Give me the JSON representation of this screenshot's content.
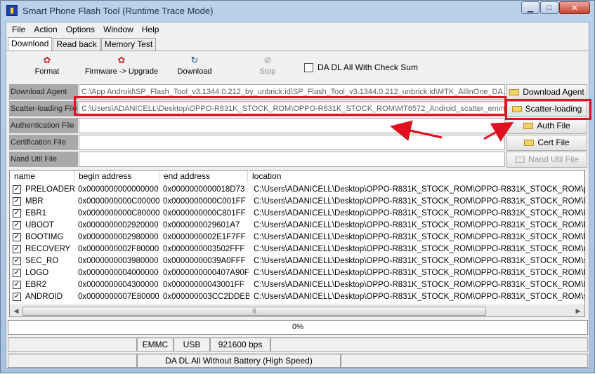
{
  "window": {
    "title": "Smart Phone Flash Tool (Runtime Trace Mode)",
    "minimize_glyph": "▁",
    "maximize_glyph": "□",
    "close_glyph": "✕"
  },
  "menu": [
    "File",
    "Action",
    "Options",
    "Window",
    "Help"
  ],
  "tabs": [
    "Download",
    "Read back",
    "Memory Test"
  ],
  "toolbar": {
    "format": "Format",
    "firmware_upgrade": "Firmware -> Upgrade",
    "download": "Download",
    "stop": "Stop",
    "checksum": "DA DL All With Check Sum"
  },
  "form": {
    "download_agent_label": "Download Agent",
    "download_agent_value": "C:\\App Android\\SP_Flash_Tool_v3.1344.0.212_by_unbrick.id\\SP_Flash_Tool_v3.1344.0.212_unbrick.id\\MTK_AllInOne_DA.bin",
    "scatter_label": "Scatter-loading File",
    "scatter_value": "C:\\Users\\ADANICELL\\Desktop\\OPPO-R831K_STOCK_ROM\\OPPO-R831K_STOCK_ROM\\MT6572_Android_scatter_emmc.txt",
    "auth_label": "Authentication File",
    "cert_label": "Certification File",
    "nand_label": "Nand Util File"
  },
  "side_buttons": {
    "download_agent": "Download Agent",
    "scatter_loading": "Scatter-loading",
    "auth_file": "Auth File",
    "cert_file": "Cert File",
    "nand_util": "Nand Util File"
  },
  "table": {
    "headers": [
      "name",
      "begin address",
      "end address",
      "location"
    ],
    "rows": [
      {
        "name": "PRELOADER",
        "begin": "0x0000000000000000",
        "end": "0x0000000000018D73",
        "location": "C:\\Users\\ADANICELL\\Desktop\\OPPO-R831K_STOCK_ROM\\OPPO-R831K_STOCK_ROM\\pre"
      },
      {
        "name": "MBR",
        "begin": "0x0000000000C00000",
        "end": "0x0000000000C001FF",
        "location": "C:\\Users\\ADANICELL\\Desktop\\OPPO-R831K_STOCK_ROM\\OPPO-R831K_STOCK_ROM\\MB"
      },
      {
        "name": "EBR1",
        "begin": "0x0000000000C80000",
        "end": "0x0000000000C801FF",
        "location": "C:\\Users\\ADANICELL\\Desktop\\OPPO-R831K_STOCK_ROM\\OPPO-R831K_STOCK_ROM\\EB"
      },
      {
        "name": "UBOOT",
        "begin": "0x0000000002920000",
        "end": "0x0000000029601A7",
        "location": "C:\\Users\\ADANICELL\\Desktop\\OPPO-R831K_STOCK_ROM\\OPPO-R831K_STOCK_ROM\\lk.b"
      },
      {
        "name": "BOOTIMG",
        "begin": "0x0000000002980000",
        "end": "0x0000000002E1F7FF",
        "location": "C:\\Users\\ADANICELL\\Desktop\\OPPO-R831K_STOCK_ROM\\OPPO-R831K_STOCK_ROM\\boo"
      },
      {
        "name": "RECOVERY",
        "begin": "0x0000000002F80000",
        "end": "0x0000000003502FFF",
        "location": "C:\\Users\\ADANICELL\\Desktop\\OPPO-R831K_STOCK_ROM\\OPPO-R831K_STOCK_ROM\\rec"
      },
      {
        "name": "SEC_RO",
        "begin": "0x0000000003980000",
        "end": "0x00000000039A0FFF",
        "location": "C:\\Users\\ADANICELL\\Desktop\\OPPO-R831K_STOCK_ROM\\OPPO-R831K_STOCK_ROM\\sec"
      },
      {
        "name": "LOGO",
        "begin": "0x0000000004000000",
        "end": "0x0000000000407A90F",
        "location": "C:\\Users\\ADANICELL\\Desktop\\OPPO-R831K_STOCK_ROM\\OPPO-R831K_STOCK_ROM\\log"
      },
      {
        "name": "EBR2",
        "begin": "0x0000000004300000",
        "end": "0x00000000043001FF",
        "location": "C:\\Users\\ADANICELL\\Desktop\\OPPO-R831K_STOCK_ROM\\OPPO-R831K_STOCK_ROM\\EB"
      },
      {
        "name": "ANDROID",
        "begin": "0x0000000007E80000",
        "end": "0x000000003CC2DDEB",
        "location": "C:\\Users\\ADANICELL\\Desktop\\OPPO-R831K_STOCK_ROM\\OPPO-R831K_STOCK_ROM\\sys"
      }
    ]
  },
  "progress": {
    "text": "0%",
    "value": 0
  },
  "status": {
    "storage": "EMMC",
    "port": "USB",
    "baud": "921600 bps",
    "mode": "DA DL All Without Battery (High Speed)"
  },
  "colors": {
    "highlight": "#e01020",
    "label_bg": "#a9a9a9"
  }
}
